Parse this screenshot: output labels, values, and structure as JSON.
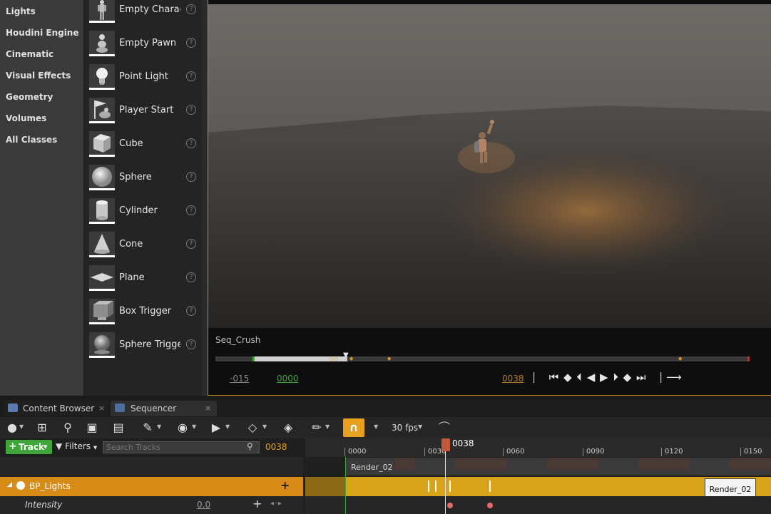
{
  "categories": [
    "Lights",
    "Houdini Engine",
    "Cinematic",
    "Visual Effects",
    "Geometry",
    "Volumes",
    "All Classes"
  ],
  "items": [
    {
      "label": "Empty Character",
      "icon": "character-icon"
    },
    {
      "label": "Empty Pawn",
      "icon": "pawn-icon"
    },
    {
      "label": "Point Light",
      "icon": "lightbulb-icon"
    },
    {
      "label": "Player Start",
      "icon": "flag-icon"
    },
    {
      "label": "Cube",
      "icon": "cube-icon"
    },
    {
      "label": "Sphere",
      "icon": "sphere-icon"
    },
    {
      "label": "Cylinder",
      "icon": "cylinder-icon"
    },
    {
      "label": "Cone",
      "icon": "cone-icon"
    },
    {
      "label": "Plane",
      "icon": "plane-icon"
    },
    {
      "label": "Box Trigger",
      "icon": "box-trigger-icon"
    },
    {
      "label": "Sphere Trigger",
      "icon": "sphere-trigger-icon"
    }
  ],
  "viewport": {
    "sequence_name": "Seq_Crush",
    "start_frame": "-015",
    "in_frame": "0000",
    "current_frame": "0038"
  },
  "tabs": [
    {
      "label": "Content Browser"
    },
    {
      "label": "Sequencer"
    }
  ],
  "toolbar": {
    "fps": "30 fps"
  },
  "sequencer": {
    "track_label": "Track",
    "filters_label": "Filters",
    "search_placeholder": "Search Tracks",
    "current_frame": "0038",
    "playhead_label": "0038",
    "ticks": [
      "0000",
      "0030",
      "0060",
      "0090",
      "0120",
      "0150"
    ],
    "shot_name": "Render_02",
    "track_name": "BP_Lights",
    "property_name": "Intensity",
    "property_value": "0.0",
    "section_label": "Render_02"
  },
  "colors": {
    "accent": "#e8a01e",
    "track_orange": "#d98b17",
    "section_gold": "#d9a31a",
    "key_red": "#e86a6a",
    "playhead": "#c0583a",
    "green": "#3fa53a"
  }
}
